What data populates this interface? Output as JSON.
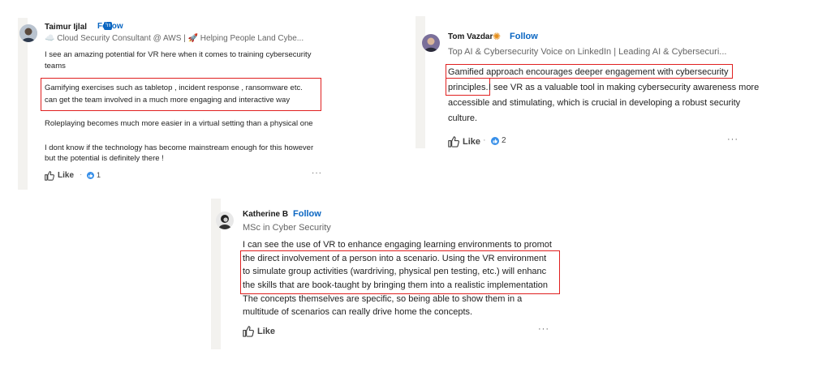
{
  "accent_color": "#0a66c2",
  "highlight_color": "#e02020",
  "comments": [
    {
      "author": "Taimur Ijlal",
      "badge": "in",
      "follow_label": "Follow",
      "headline": "☁️ Cloud Security Consultant @ AWS | 🚀 Helping People Land Cybe...",
      "body_lines": [
        "I see an amazing potential for VR here when it comes to training cybersecurity",
        "teams",
        "Gamifying exercises such as tabletop , incident response , ransomware etc.",
        "can get the team involved in a much more engaging and interactive way",
        "Roleplaying becomes much more easier in a virtual setting than a physical one",
        "I dont know if the technology has become mainstream enough for this however",
        "but the potential is definitely there !"
      ],
      "like_label": "Like",
      "reaction_count": "1",
      "more_label": "···"
    },
    {
      "author": "Tom Vazdar",
      "follow_label": "Follow",
      "headline": "Top AI & Cybersecurity Voice on LinkedIn | Leading AI & Cybersecuri...",
      "body_lines": [
        "Gamified approach encourages deeper engagement with cybersecurity",
        "principles.",
        " I see VR as a valuable tool in making cybersecurity awareness more",
        "accessible and stimulating, which is crucial in developing a robust security",
        "culture."
      ],
      "like_label": "Like",
      "reaction_count": "2",
      "more_label": "···"
    },
    {
      "author": "Katherine B",
      "follow_label": "Follow",
      "headline": "MSc in Cyber Security",
      "body_lines": [
        "I can see the use of VR to enhance engaging learning environments to promot",
        "the direct involvement of a person into a scenario. Using the VR environment",
        "to simulate group activities (wardriving, physical pen testing, etc.) will enhanc",
        "the skills that are book-taught by bringing them into a realistic implementation",
        "The concepts themselves are specific, so being able to show them in a",
        "multitude of scenarios can really drive home the concepts."
      ],
      "like_label": "Like",
      "more_label": "···"
    }
  ]
}
